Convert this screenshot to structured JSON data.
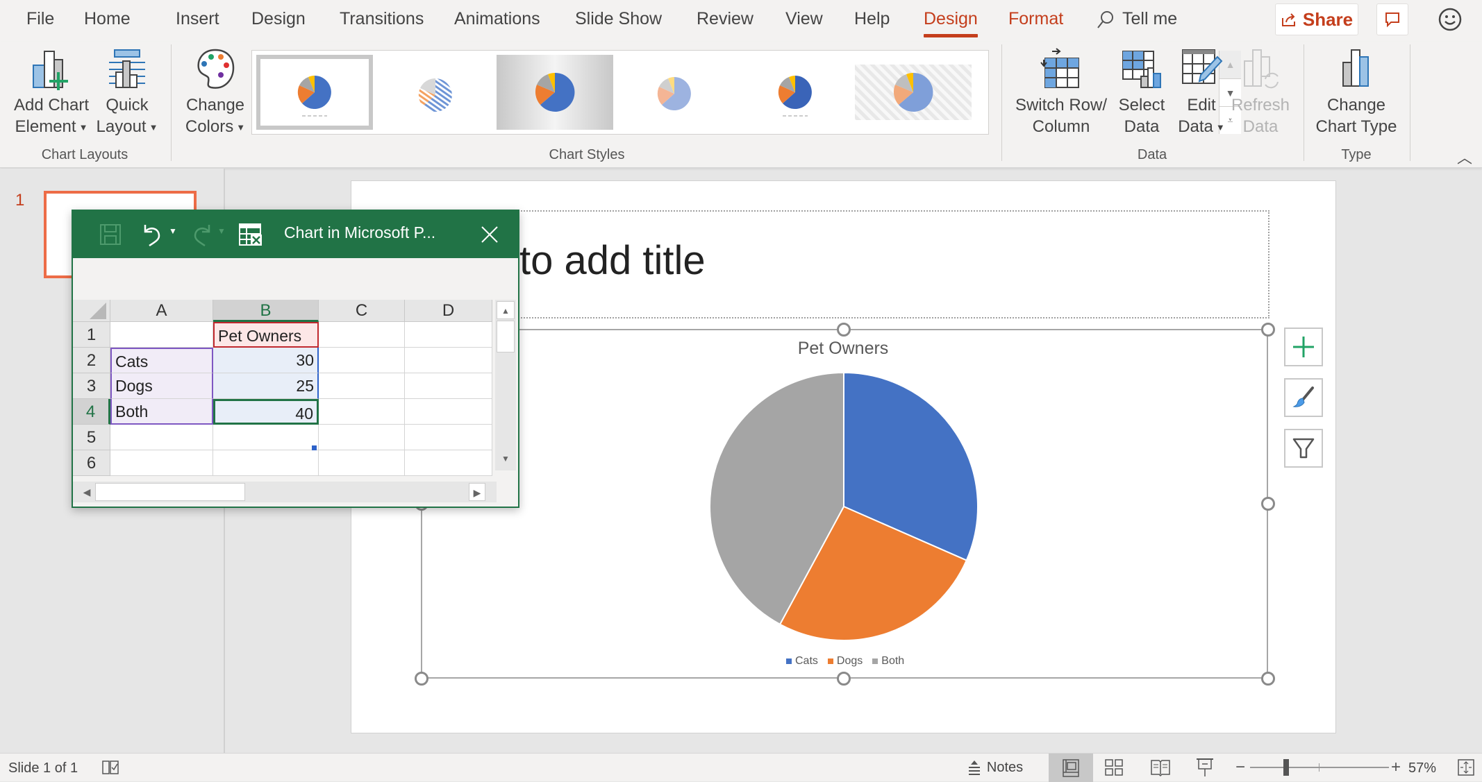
{
  "menubar": {
    "tabs": [
      {
        "label": "File"
      },
      {
        "label": "Home"
      },
      {
        "label": "Insert"
      },
      {
        "label": "Design"
      },
      {
        "label": "Transitions"
      },
      {
        "label": "Animations"
      },
      {
        "label": "Slide Show"
      },
      {
        "label": "Review"
      },
      {
        "label": "View"
      },
      {
        "label": "Help"
      },
      {
        "label": "Design",
        "contextual": true,
        "active": true
      },
      {
        "label": "Format",
        "contextual": true
      }
    ],
    "tell_me": "Tell me",
    "share": "Share"
  },
  "ribbon": {
    "chart_layouts": {
      "label": "Chart Layouts",
      "add_chart_element": [
        "Add Chart",
        "Element"
      ],
      "quick_layout": [
        "Quick",
        "Layout"
      ]
    },
    "change_colors": [
      "Change",
      "Colors"
    ],
    "chart_styles": {
      "label": "Chart Styles",
      "styles": [
        "Style 1",
        "Style 2",
        "Style 3",
        "Style 4",
        "Style 5",
        "Style 6"
      ],
      "selected_index": 0
    },
    "data": {
      "label": "Data",
      "switch_row_column": [
        "Switch Row/",
        "Column"
      ],
      "select_data": [
        "Select",
        "Data"
      ],
      "edit_data": [
        "Edit",
        "Data"
      ],
      "refresh_data": [
        "Refresh",
        "Data"
      ]
    },
    "type": {
      "label": "Type",
      "change_chart_type": [
        "Change",
        "Chart Type"
      ]
    }
  },
  "slides_pane": {
    "slide_number": "1"
  },
  "slide": {
    "title_placeholder": "to add title"
  },
  "excel_window": {
    "title": "Chart in Microsoft P...",
    "columns": [
      "A",
      "B",
      "C",
      "D"
    ],
    "rows": [
      "1",
      "2",
      "3",
      "4",
      "5",
      "6"
    ],
    "cells": [
      [
        "",
        "Pet Owners",
        "",
        ""
      ],
      [
        "Cats",
        "30",
        "",
        ""
      ],
      [
        "Dogs",
        "25",
        "",
        ""
      ],
      [
        "Both",
        "40",
        "",
        ""
      ],
      [
        "",
        "",
        "",
        ""
      ],
      [
        "",
        "",
        "",
        ""
      ]
    ],
    "selected_cell": "B4"
  },
  "chart_data": {
    "type": "pie",
    "title": "Pet Owners",
    "categories": [
      "Cats",
      "Dogs",
      "Both"
    ],
    "values": [
      30,
      25,
      40
    ],
    "colors": [
      "#4472c4",
      "#ed7d31",
      "#a5a5a5"
    ],
    "legend_position": "bottom"
  },
  "statusbar": {
    "slide_info": "Slide 1 of 1",
    "notes": "Notes",
    "zoom": "57%",
    "zoom_level_percent": 57
  },
  "colors": {
    "accent": "#c43e1c",
    "excel_green": "#217346"
  }
}
